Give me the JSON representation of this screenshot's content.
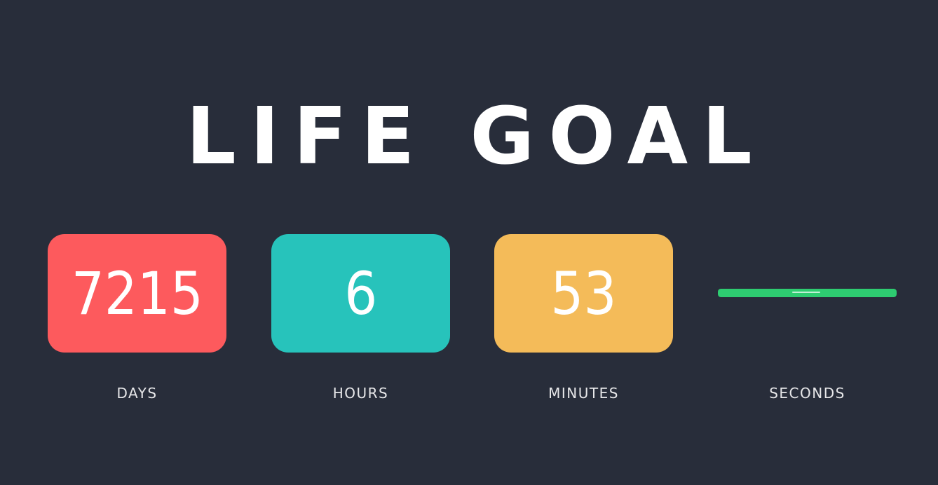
{
  "title": "LIFE GOAL",
  "countdown": {
    "days": {
      "value": "7215",
      "label": "DAYS",
      "color": "#fd5a5d"
    },
    "hours": {
      "value": "6",
      "label": "HOURS",
      "color": "#27c3bb"
    },
    "minutes": {
      "value": "53",
      "label": "MINUTES",
      "color": "#f4bb59"
    },
    "seconds": {
      "value": "",
      "label": "SECONDS",
      "color": "#2ecc71",
      "fill_fraction": 1.0
    }
  }
}
